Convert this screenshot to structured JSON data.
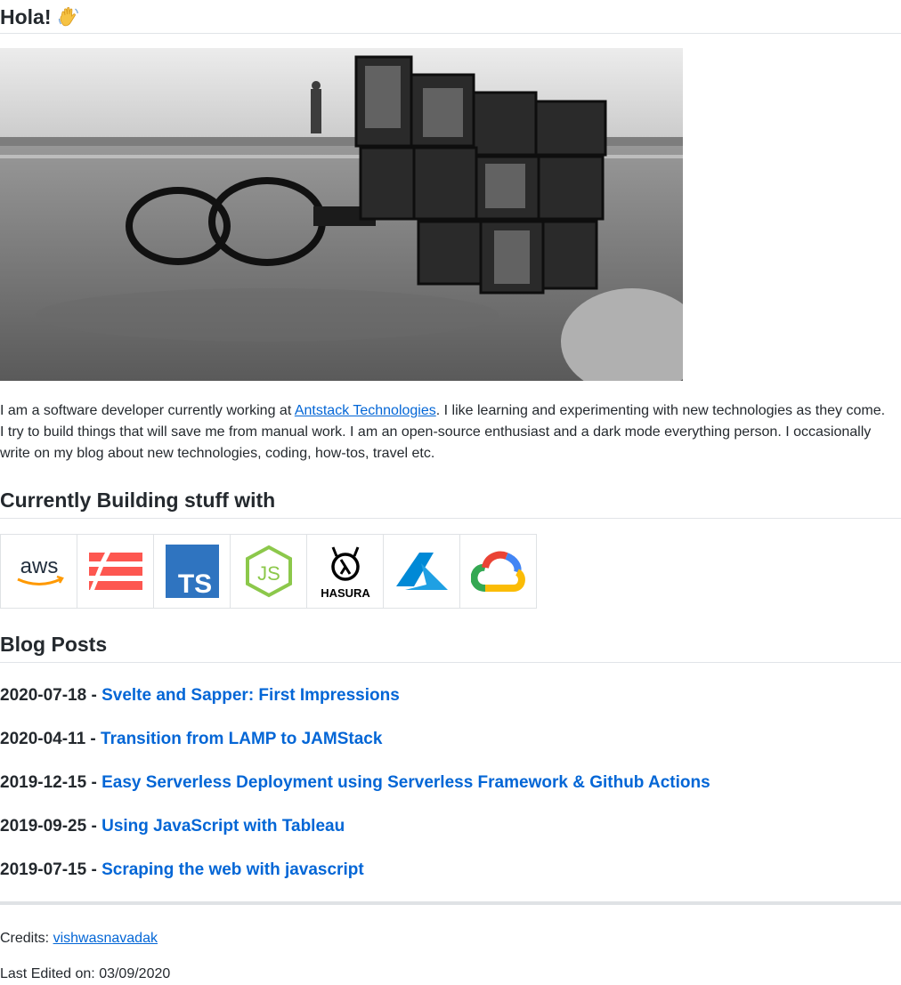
{
  "header": {
    "title": "Hola!",
    "emoji": "wave-emoji"
  },
  "hero": {
    "alt": "black and white photo of glasses and a mirror cube on a beach"
  },
  "intro": {
    "before": "I am a software developer currently working at ",
    "link": "Antstack Technologies",
    "after": ". I like learning and experimenting with new technologies as they come. I try to build things that will save me from manual work. I am an open-source enthusiast and a dark mode everything person. I occasionally write on my blog about new technologies, coding, how-tos, travel etc."
  },
  "building": {
    "title": "Currently Building stuff with",
    "tools": [
      {
        "name": "aws-icon",
        "label": "aws"
      },
      {
        "name": "serverless-framework-icon",
        "label": ""
      },
      {
        "name": "typescript-icon",
        "label": "TS"
      },
      {
        "name": "nodejs-icon",
        "label": "JS"
      },
      {
        "name": "hasura-icon",
        "label": "HASURA"
      },
      {
        "name": "azure-icon",
        "label": ""
      },
      {
        "name": "google-cloud-icon",
        "label": ""
      }
    ]
  },
  "blog": {
    "title": "Blog Posts",
    "posts": [
      {
        "date": "2020-07-18",
        "title": "Svelte and Sapper: First Impressions"
      },
      {
        "date": "2020-04-11",
        "title": "Transition from LAMP to JAMStack"
      },
      {
        "date": "2019-12-15",
        "title": "Easy Serverless Deployment using Serverless Framework & Github Actions"
      },
      {
        "date": "2019-09-25",
        "title": "Using JavaScript with Tableau"
      },
      {
        "date": "2019-07-15",
        "title": "Scraping the web with javascript"
      }
    ]
  },
  "footer": {
    "credits_label": "Credits: ",
    "credits_link": "vishwasnavadak",
    "edited": "Last Edited on: 03/09/2020"
  },
  "colors": {
    "link": "#0366d6",
    "text": "#24292e",
    "border": "#e1e4e8"
  }
}
